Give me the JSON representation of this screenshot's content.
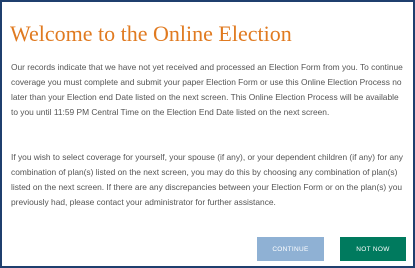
{
  "dialog": {
    "title": "Welcome to the Online Election",
    "paragraphs": [
      "Our records indicate that we have not yet received and processed an Election Form from you. To continue coverage you must complete and submit your paper Election Form or use this Online Election Process no later than your Election end Date listed on the next screen. This Online Election Process will be available to you until 11:59 PM Central Time on the Election End Date listed on the next screen.",
      "If you wish to select coverage for yourself, your spouse (if any), or your dependent children (if any) for any combination of plan(s) listed on the next screen, you may do this by choosing any combination of plan(s) listed on the next screen. If there are any discrepancies between your Election Form or on the plan(s) you previously had, please contact your administrator for further assistance."
    ],
    "buttons": {
      "continue_label": "CONTINUE",
      "not_now_label": "NOT NOW"
    }
  },
  "colors": {
    "title": "#e07a20",
    "border": "#1f3f6e",
    "body_text": "#555555",
    "continue_button": "#8fb1d4",
    "not_now_button": "#007a5e"
  }
}
